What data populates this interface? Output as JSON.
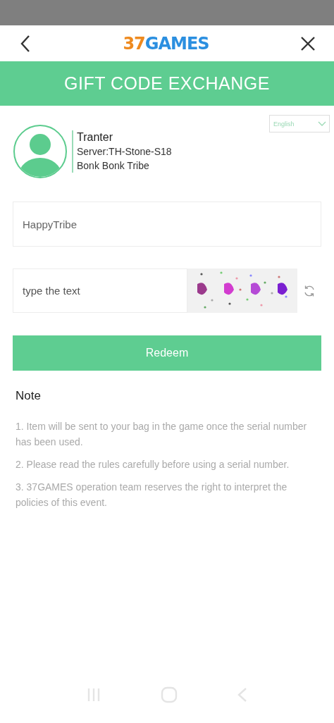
{
  "header": {
    "logo": {
      "accent": "37",
      "main": "GAMES"
    }
  },
  "banner": {
    "title": "GIFT CODE EXCHANGE"
  },
  "language": {
    "value": "English"
  },
  "profile": {
    "name": "Tranter",
    "server": "Server:TH-Stone-S18",
    "tribe": "Bonk Bonk Tribe"
  },
  "code_field": {
    "value": "HappyTribe"
  },
  "captcha_field": {
    "placeholder": "type the text"
  },
  "redeem_button": {
    "label": "Redeem"
  },
  "note": {
    "title": "Note",
    "items": [
      "1. Item will be sent to your bag in the game once the serial number has been used.",
      "2. Please read the rules carefully before using a serial number.",
      "3. 37GAMES operation team reserves the right to interpret the policies of this event."
    ]
  }
}
